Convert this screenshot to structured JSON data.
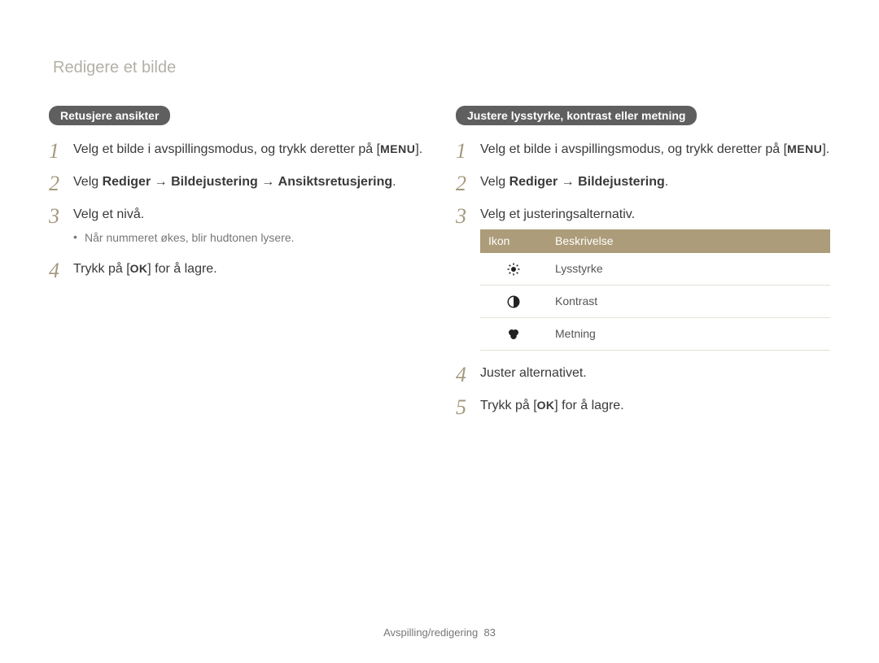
{
  "page_title": "Redigere et bilde",
  "left": {
    "heading": "Retusjere ansikter",
    "steps": [
      {
        "text_before": "Velg et bilde i avspillingsmodus, og trykk deretter på ",
        "button": "MENU",
        "text_after": "."
      },
      {
        "text": "Velg ",
        "path": [
          "Rediger",
          "Bildejustering",
          "Ansiktsretusjering"
        ],
        "suffix": "."
      },
      {
        "text": "Velg et nivå.",
        "bullets": [
          "Når nummeret økes, blir hudtonen lysere."
        ]
      },
      {
        "text_before": "Trykk på ",
        "button": "OK",
        "text_after": " for å lagre."
      }
    ]
  },
  "right": {
    "heading": "Justere lysstyrke, kontrast eller metning",
    "steps": [
      {
        "text_before": "Velg et bilde i avspillingsmodus, og trykk deretter på ",
        "button": "MENU",
        "text_after": "."
      },
      {
        "text": "Velg ",
        "path": [
          "Rediger",
          "Bildejustering"
        ],
        "suffix": "."
      },
      {
        "text": "Velg et justeringsalternativ.",
        "table": {
          "headers": [
            "Ikon",
            "Beskrivelse"
          ],
          "rows": [
            {
              "icon": "brightness-icon",
              "label": "Lysstyrke"
            },
            {
              "icon": "contrast-icon",
              "label": "Kontrast"
            },
            {
              "icon": "saturation-icon",
              "label": "Metning"
            }
          ]
        }
      },
      {
        "text": "Juster alternativet."
      },
      {
        "text_before": "Trykk på ",
        "button": "OK",
        "text_after": " for å lagre."
      }
    ]
  },
  "footer": {
    "section": "Avspilling/redigering",
    "page": "83"
  }
}
